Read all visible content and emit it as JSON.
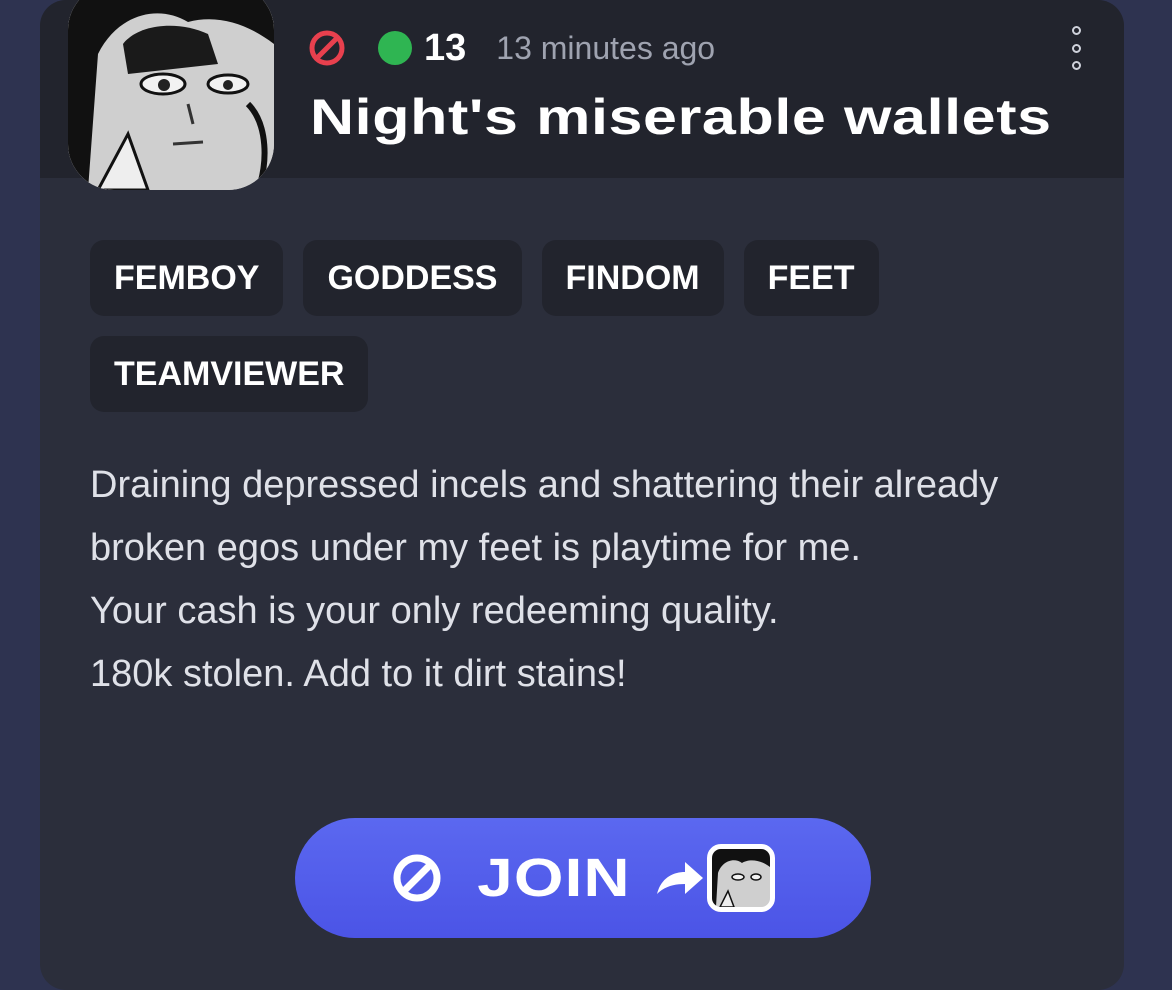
{
  "server": {
    "member_count": "13",
    "time_ago": "13 minutes ago",
    "title": "Night's miserable wallets",
    "tags": [
      "FEMBOY",
      "GODDESS",
      "FINDOM",
      "FEET",
      "TEAMVIEWER"
    ],
    "description": [
      "Draining depressed incels and shattering their already broken egos under my feet is playtime for me.",
      "Your cash is your only redeeming quality.",
      "180k stolen. Add to it dirt stains!"
    ]
  },
  "join_button": {
    "label": "JOIN"
  },
  "colors": {
    "page_background": "#2e3350",
    "card_background": "#2b2e3b",
    "header_background": "#22242d",
    "ban_icon": "#e8404e",
    "online_dot": "#2fb552",
    "button_gradient_top": "#5b68f0",
    "button_gradient_bottom": "#4b54e6"
  },
  "icons": {
    "status": "ban-icon",
    "online": "online-dot",
    "menu": "more-vertical-icon",
    "join_prefix": "ban-icon",
    "join_suffix": "share-arrow-icon"
  }
}
